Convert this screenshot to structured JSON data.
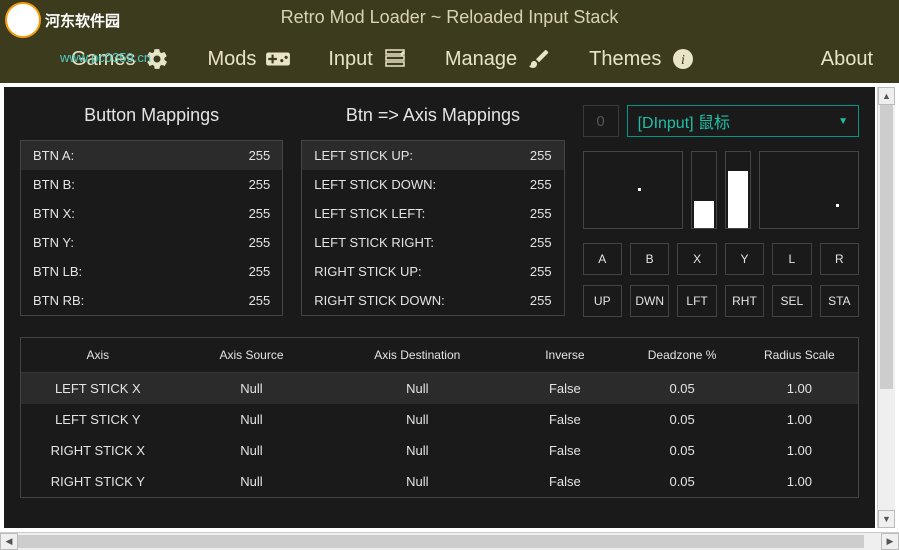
{
  "app": {
    "title": "Retro Mod Loader ~ Reloaded Input Stack",
    "watermark_text": "河东软件园",
    "watermark_url": "www.pc0359.cn"
  },
  "nav": [
    {
      "label": "Games",
      "icon": "gears"
    },
    {
      "label": "Mods",
      "icon": "gamepad"
    },
    {
      "label": "Input",
      "icon": "form"
    },
    {
      "label": "Manage",
      "icon": "brush"
    },
    {
      "label": "Themes",
      "icon": "info"
    },
    {
      "label": "About",
      "icon": ""
    }
  ],
  "sections": {
    "button_mappings": {
      "title": "Button Mappings",
      "rows": [
        {
          "label": "BTN A:",
          "value": "255"
        },
        {
          "label": "BTN B:",
          "value": "255"
        },
        {
          "label": "BTN X:",
          "value": "255"
        },
        {
          "label": "BTN Y:",
          "value": "255"
        },
        {
          "label": "BTN LB:",
          "value": "255"
        },
        {
          "label": "BTN RB:",
          "value": "255"
        }
      ]
    },
    "axis_mappings": {
      "title": "Btn => Axis Mappings",
      "rows": [
        {
          "label": "LEFT STICK UP:",
          "value": "255"
        },
        {
          "label": "LEFT STICK DOWN:",
          "value": "255"
        },
        {
          "label": "LEFT STICK LEFT:",
          "value": "255"
        },
        {
          "label": "LEFT STICK RIGHT:",
          "value": "255"
        },
        {
          "label": "RIGHT STICK UP:",
          "value": "255"
        },
        {
          "label": "RIGHT STICK DOWN:",
          "value": "255"
        }
      ]
    }
  },
  "device": {
    "index": "0",
    "selected": "[DInput] 鼠标"
  },
  "button_grid": {
    "row1": [
      "A",
      "B",
      "X",
      "Y",
      "L",
      "R"
    ],
    "row2": [
      "UP",
      "DWN",
      "LFT",
      "RHT",
      "SEL",
      "STA"
    ]
  },
  "axis_table": {
    "headers": [
      "Axis",
      "Axis Source",
      "Axis Destination",
      "Inverse",
      "Deadzone %",
      "Radius Scale"
    ],
    "rows": [
      {
        "axis": "LEFT STICK X",
        "source": "Null",
        "dest": "Null",
        "inverse": "False",
        "deadzone": "0.05",
        "radius": "1.00"
      },
      {
        "axis": "LEFT STICK Y",
        "source": "Null",
        "dest": "Null",
        "inverse": "False",
        "deadzone": "0.05",
        "radius": "1.00"
      },
      {
        "axis": "RIGHT STICK X",
        "source": "Null",
        "dest": "Null",
        "inverse": "False",
        "deadzone": "0.05",
        "radius": "1.00"
      },
      {
        "axis": "RIGHT STICK Y",
        "source": "Null",
        "dest": "Null",
        "inverse": "False",
        "deadzone": "0.05",
        "radius": "1.00"
      }
    ]
  }
}
